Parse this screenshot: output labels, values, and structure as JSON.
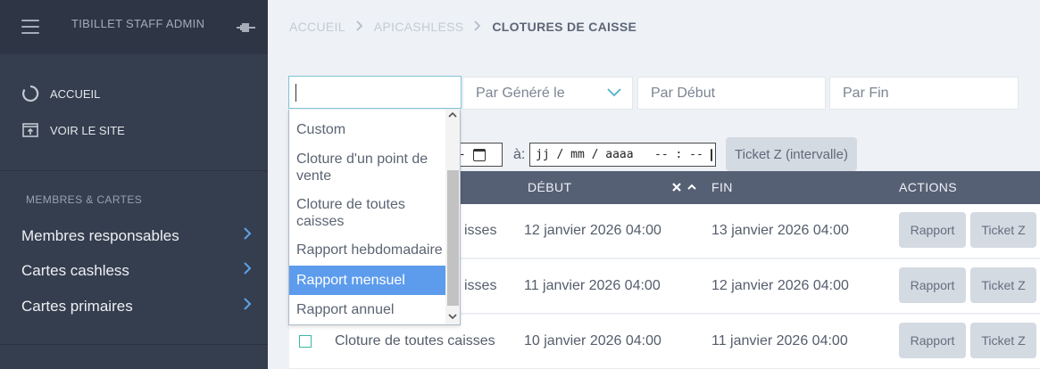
{
  "sidebar": {
    "title": "TIBILLET STAFF ADMIN",
    "nav": [
      {
        "label": "ACCUEIL"
      },
      {
        "label": "VOIR LE SITE"
      }
    ],
    "section": "MEMBRES & CARTES",
    "links": [
      {
        "label": "Membres responsables"
      },
      {
        "label": "Cartes cashless"
      },
      {
        "label": "Cartes primaires"
      }
    ]
  },
  "breadcrumb": {
    "items": [
      "ACCUEIL",
      "APICASHLESS",
      "CLOTURES DE CAISSE"
    ]
  },
  "filters": {
    "select_label": "Par Généré le",
    "debut_placeholder": "Par Début",
    "fin_placeholder": "Par Fin"
  },
  "interval": {
    "date_end_fragment": "-- ",
    "a_label": "à:",
    "date_placeholder": "jj / mm / aaaa   -- : --",
    "ticket_button": "Ticket Z (intervalle)"
  },
  "dropdown": {
    "options": [
      {
        "label": "Custom"
      },
      {
        "label": "Cloture d'un point de vente"
      },
      {
        "label": "Cloture de toutes caisses"
      },
      {
        "label": "Rapport hebdomadaire"
      },
      {
        "label": "Rapport mensuel"
      },
      {
        "label": "Rapport annuel"
      }
    ],
    "selected": "Rapport mensuel"
  },
  "table": {
    "headers": {
      "debut": "DÉBUT",
      "fin": "FIN",
      "actions": "ACTIONS"
    },
    "rows": [
      {
        "type_fragment": "isses",
        "debut": "12 janvier 2026 04:00",
        "fin": "13 janvier 2026 04:00",
        "rapport": "Rapport",
        "ticket": "Ticket Z"
      },
      {
        "type_fragment": "isses",
        "debut": "11 janvier 2026 04:00",
        "fin": "12 janvier 2026 04:00",
        "rapport": "Rapport",
        "ticket": "Ticket Z"
      },
      {
        "type": "Cloture de toutes caisses",
        "debut": "10 janvier 2026 04:00",
        "fin": "11 janvier 2026 04:00",
        "rapport": "Rapport",
        "ticket": "Ticket Z"
      }
    ]
  },
  "colors": {
    "sidebar_bg": "#353e4f",
    "table_header_bg": "#566075",
    "selected_option": "#5d9cec",
    "checkbox": "#3bb8a3"
  }
}
